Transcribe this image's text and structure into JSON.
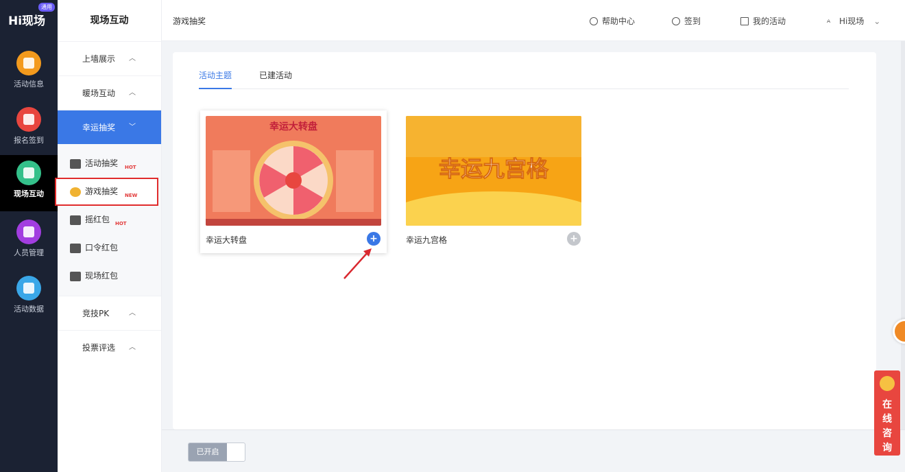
{
  "brand": {
    "logo": "Hi现场",
    "badge": "通用"
  },
  "rail": [
    {
      "label": "活动信息",
      "color": "#f39a1d"
    },
    {
      "label": "报名签到",
      "color": "#e8463f"
    },
    {
      "label": "现场互动",
      "color": "#34c08a"
    },
    {
      "label": "人员管理",
      "color": "#a23de0"
    },
    {
      "label": "活动数据",
      "color": "#3aa7e8"
    }
  ],
  "submenu": {
    "title": "现场互动",
    "groups": [
      {
        "label": "上墙展示",
        "chevron": "^"
      },
      {
        "label": "暖场互动",
        "chevron": "^"
      },
      {
        "label": "幸运抽奖",
        "chevron": "v"
      }
    ],
    "items": [
      {
        "label": "活动抽奖",
        "tag": "HOT"
      },
      {
        "label": "游戏抽奖",
        "tag": "NEW"
      },
      {
        "label": "摇红包",
        "tag": "HOT"
      },
      {
        "label": "口令红包",
        "tag": ""
      },
      {
        "label": "现场红包",
        "tag": ""
      }
    ],
    "groups_after": [
      {
        "label": "竞技PK",
        "chevron": "^"
      },
      {
        "label": "投票评选",
        "chevron": "^"
      }
    ]
  },
  "topbar": {
    "breadcrumb": "游戏抽奖",
    "help": "帮助中心",
    "signin": "签到",
    "my_activity": "我的活动",
    "user": "Hi现场"
  },
  "tabs": [
    {
      "label": "活动主题"
    },
    {
      "label": "已建活动"
    }
  ],
  "cards": [
    {
      "name": "幸运大转盘",
      "thumb_title": "幸运大转盘",
      "plus": "+"
    },
    {
      "name": "幸运九宫格",
      "thumb_title": "幸运九宫格",
      "plus": "+"
    }
  ],
  "bottom": {
    "toggle_label": "已开启"
  },
  "consult": {
    "label": "在线咨询"
  },
  "colors": {
    "accent": "#3a78e6",
    "highlight": "#e02b2b",
    "rail_bg": "#1b2233"
  }
}
